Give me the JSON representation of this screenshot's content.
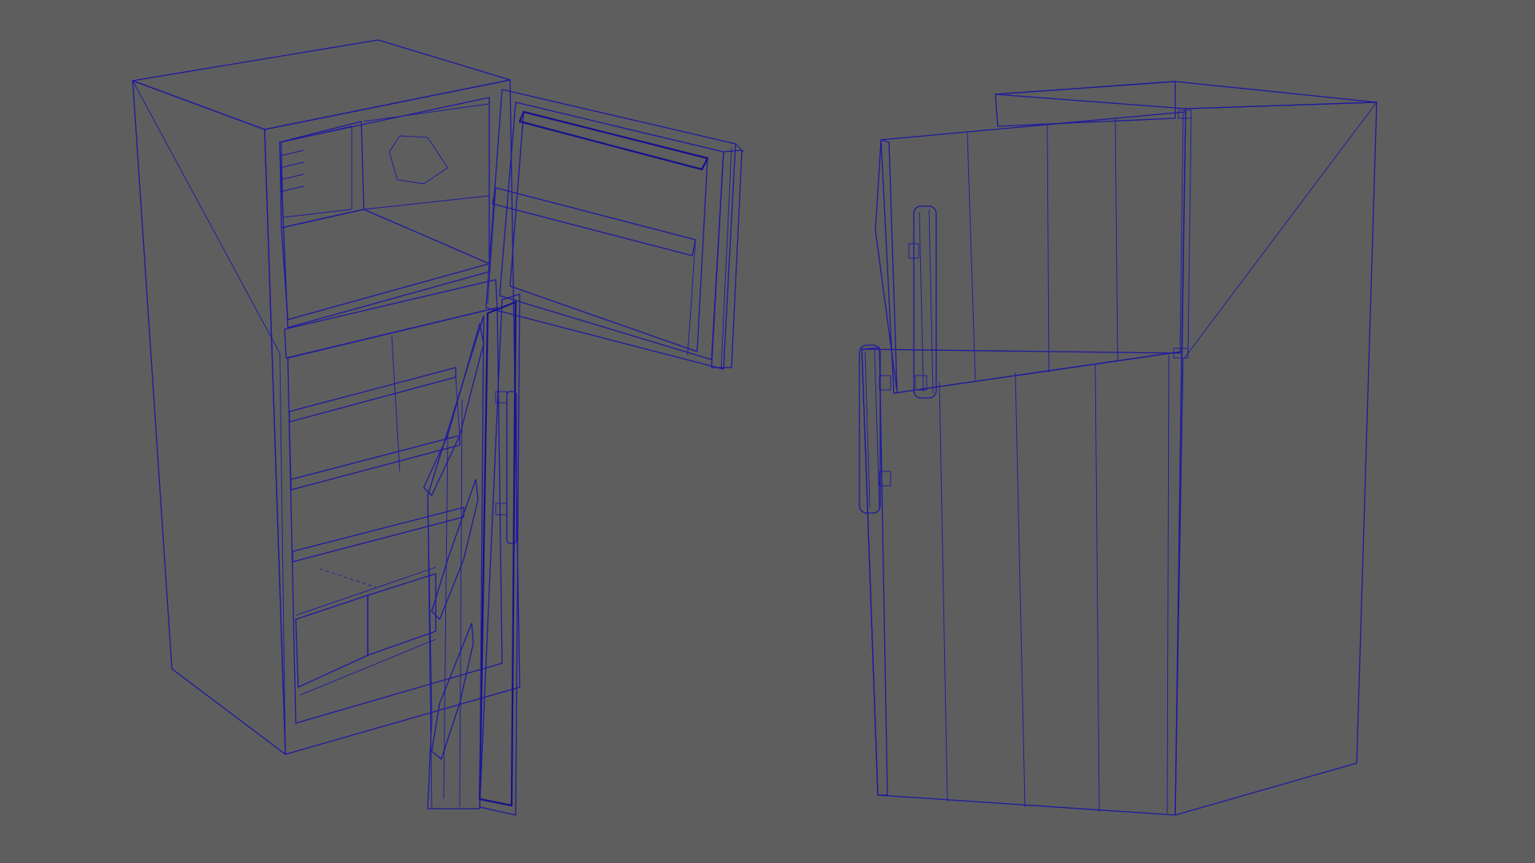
{
  "viewport": {
    "background_color": "#5e5e5e",
    "wireframe_color": "#1e1aa0",
    "objects": [
      {
        "name": "refrigerator-open-doors",
        "freezer_door": "open",
        "fresh_food_door": "open",
        "shelves": 3,
        "crisper_drawers": 2
      },
      {
        "name": "refrigerator-closed-doors",
        "freezer_door": "closed",
        "fresh_food_door": "closed",
        "handles": 2
      }
    ]
  }
}
